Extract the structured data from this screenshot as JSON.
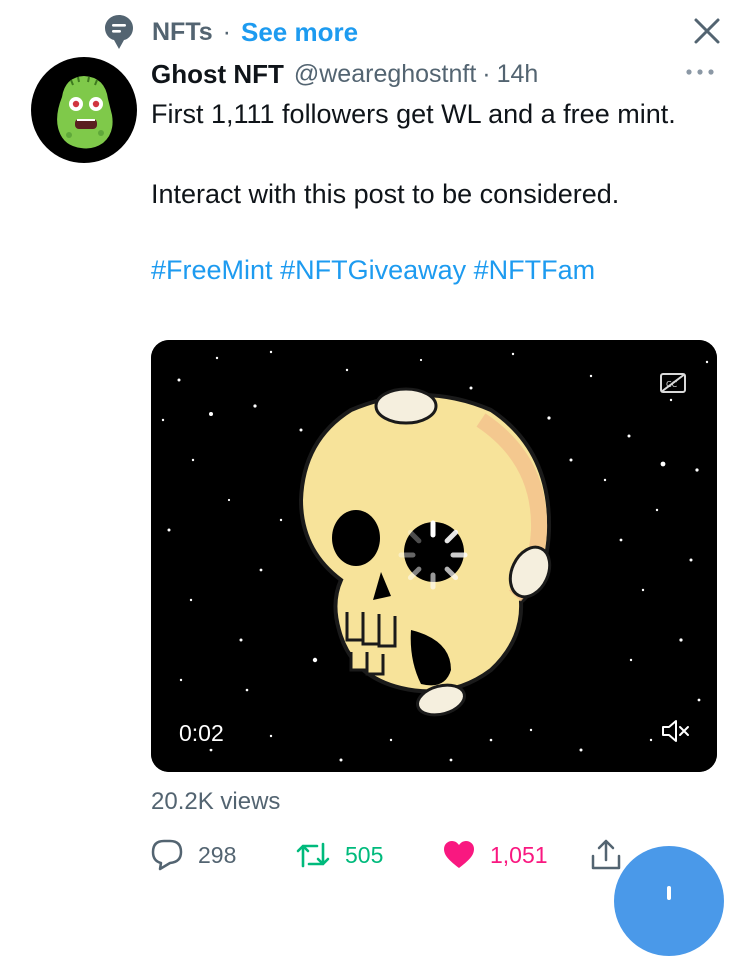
{
  "topic": {
    "name": "NFTs",
    "separator": "·",
    "see_more": "See more"
  },
  "tweet": {
    "author_name": "Ghost NFT",
    "handle": "@weareghostnft",
    "time_separator": "·",
    "time": "14h",
    "text_line_1": "First 1,111 followers get WL and a free mint.",
    "text_line_2": "Interact with this post to be considered.",
    "hashtags": [
      "#FreeMint",
      "#NFTGiveaway",
      "#NFTFam"
    ]
  },
  "media": {
    "duration": "0:02",
    "cc_icon": "closed-captions-icon",
    "mute_icon": "volume-muted-icon"
  },
  "views": "20.2K views",
  "actions": {
    "replies": "298",
    "retweets": "505",
    "likes": "1,051"
  },
  "colors": {
    "accent": "#1d9bf0",
    "retweet": "#00ba7c",
    "like": "#f91880",
    "secondary_text": "#536471"
  }
}
